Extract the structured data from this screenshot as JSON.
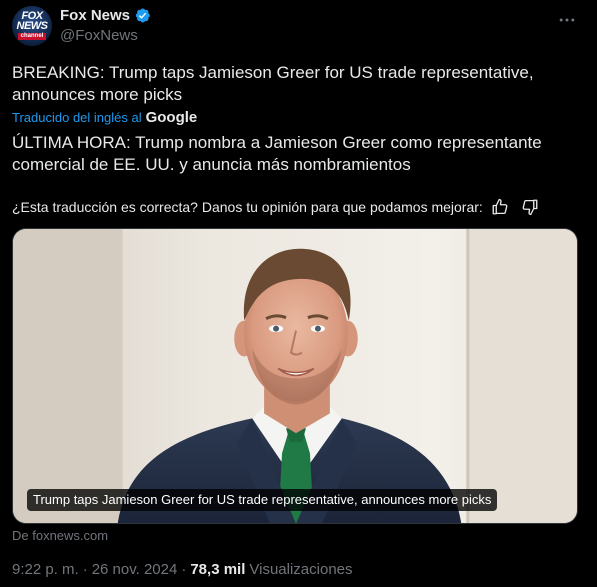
{
  "author": {
    "name": "Fox News",
    "handle": "@FoxNews",
    "avatar_text_top": "FOX\nNEWS",
    "avatar_text_bottom": "channel"
  },
  "tweet": {
    "text_original": "BREAKING: Trump taps Jamieson Greer for US trade representative, announces more picks",
    "translated_label": "Traducido del inglés al",
    "translation_provider": "Google",
    "text_translated": "ÚLTIMA HORA: Trump nombra a Jamieson Greer como representante comercial de EE. UU. y anuncia más nombramientos",
    "feedback_prompt": "¿Esta traducción es correcta? Danos tu opinión para que podamos mejorar:"
  },
  "card": {
    "caption": "Trump taps Jamieson Greer for US trade representative, announces more picks",
    "source": "De foxnews.com"
  },
  "meta": {
    "time": "9:22 p. m.",
    "separator": "·",
    "date": "26 nov. 2024",
    "views_count": "78,3 mil",
    "views_label": "Visualizaciones"
  },
  "icons": {
    "verified": "verified-badge-icon",
    "more": "more-options-icon",
    "thumbs_up": "thumbs-up-icon",
    "thumbs_down": "thumbs-down-icon"
  },
  "colors": {
    "background": "#000000",
    "text": "#e7e9ea",
    "secondary": "#71767b",
    "link": "#1d9bf0",
    "verified": "#1d9bf0"
  }
}
